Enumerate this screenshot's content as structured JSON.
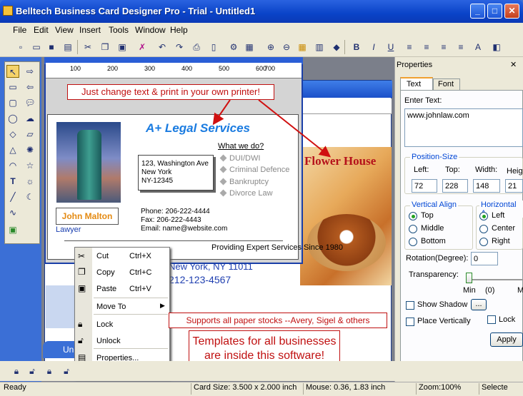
{
  "window": {
    "title": "Belltech Business Card Designer Pro  - Trial - Untitled1",
    "btn_min": "_",
    "btn_max": "□",
    "btn_close": "✕"
  },
  "menu": [
    "File",
    "Edit",
    "View",
    "Insert",
    "Tools",
    "Window",
    "Help"
  ],
  "ruler_front": [
    "100",
    "200",
    "300",
    "400",
    "500",
    "600",
    "700"
  ],
  "bg_doc": {
    "flower_house": "Flower House",
    "line1": "New York, NY 11011",
    "line2": "212-123-4567",
    "tab": "Un"
  },
  "card": {
    "title": "A+ Legal Services",
    "name": "John Malton",
    "role": "Lawyer",
    "address": [
      "123, Washington Ave",
      "New York",
      "NY-12345"
    ],
    "what_we_do": "What we do?",
    "services": [
      "DUI/DWI",
      "Criminal Defence",
      "Bankruptcy",
      "Divorce Law"
    ],
    "phone": "Phone: 206-222-4444",
    "fax": "Fax: 206-222-4443",
    "email": "Email: name@website.com",
    "tagline": "Providing Expert Services Since 1980"
  },
  "callouts": {
    "top": "Just change text & print in your own printer!",
    "paper": "Supports all paper stocks --Avery, Sigel & others",
    "templates_1": "Templates for all businesses",
    "templates_2": "are inside this software!"
  },
  "context_menu": {
    "cut": "Cut",
    "cut_key": "Ctrl+X",
    "copy": "Copy",
    "copy_key": "Ctrl+C",
    "paste": "Paste",
    "paste_key": "Ctrl+V",
    "move_to": "Move To",
    "lock": "Lock",
    "unlock": "Unlock",
    "properties": "Properties..."
  },
  "properties": {
    "title": "Properties",
    "tab_text": "Text",
    "tab_font": "Font",
    "enter_text": "Enter Text:",
    "text_value": "www.johnlaw.com",
    "position_size": "Position-Size",
    "left_label": "Left:",
    "top_label": "Top:",
    "width_label": "Width:",
    "height_label": "Heig",
    "left": "72",
    "top": "228",
    "width": "148",
    "height": "21",
    "vertical_align": "Vertical Align",
    "v_top": "Top",
    "v_middle": "Middle",
    "v_bottom": "Bottom",
    "horizontal_align": "Horizontal A",
    "h_left": "Left",
    "h_center": "Center",
    "h_right": "Right",
    "rotation_label": "Rotation(Degree):",
    "rotation": "0",
    "transparency": "Transparency:",
    "min": "Min",
    "zero": "(0)",
    "max": "M",
    "show_shadow": "Show Shadow",
    "ellipsis": "...",
    "place_vertically": "Place Vertically",
    "lock": "Lock",
    "apply": "Apply"
  },
  "status": {
    "ready": "Ready",
    "card_size": "Card Size: 3.500 x 2.000 inch",
    "mouse": "Mouse: 0.36, 1.83 inch",
    "zoom": "Zoom:100%",
    "select": "Selecte"
  }
}
